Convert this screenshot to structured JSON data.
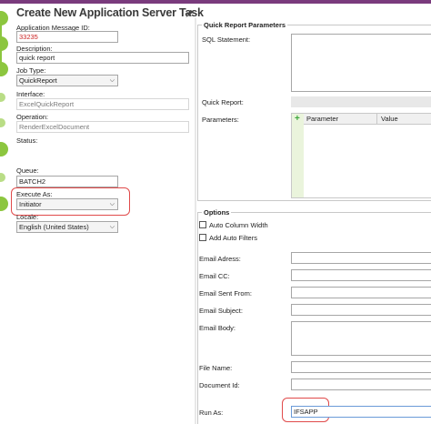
{
  "header": {
    "title": "Create New Application Server Task",
    "pin_icon": "pin-icon"
  },
  "left": {
    "app_message_id_label": "Application Message ID:",
    "app_message_id_value": "33235",
    "description_label": "Description:",
    "description_value": "quick report",
    "job_type_label": "Job Type:",
    "job_type_value": "QuickReport",
    "interface_label": "Interface:",
    "interface_value": "ExcelQuickReport",
    "operation_label": "Operation:",
    "operation_value": "RenderExcelDocument",
    "status_label": "Status:",
    "queue_label": "Queue:",
    "queue_value": "BATCH2",
    "execute_as_label": "Execute As:",
    "execute_as_value": "Initiator",
    "locale_label": "Locale:",
    "locale_value": "English (United States)"
  },
  "quick_report": {
    "group_title": "Quick Report Parameters",
    "sql_label": "SQL Statement:",
    "quick_report_label": "Quick Report:",
    "parameters_label": "Parameters:",
    "col_parameter": "Parameter",
    "col_value": "Value"
  },
  "options": {
    "group_title": "Options",
    "auto_column_width": "Auto Column Width",
    "auto_add_filters": "Add Auto Filters",
    "email_address": "Email Adress:",
    "email_cc": "Email CC:",
    "email_sent_from": "Email Sent From:",
    "email_subject": "Email Subject:",
    "email_body": "Email Body:",
    "file_name": "File Name:",
    "document_id": "Document Id:",
    "run_as_label": "Run As:",
    "run_as_value": "IFSAPP"
  },
  "colors": {
    "accent": "#7a3b7d",
    "step": "#8cc63f",
    "highlight": "#e04a4a"
  }
}
